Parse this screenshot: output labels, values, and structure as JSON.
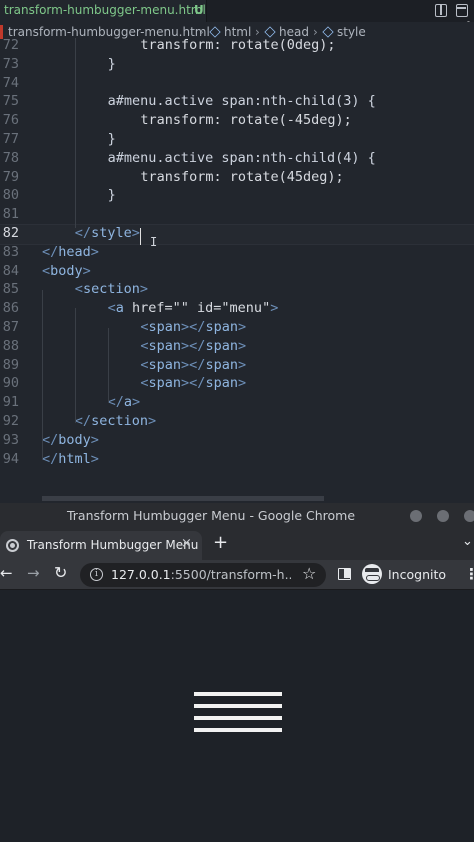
{
  "editor": {
    "tab": {
      "filename": "transform-humbugger-menu.html",
      "status": "U"
    },
    "breadcrumb": [
      {
        "label": "transform-humbugger-menu.html"
      },
      {
        "label": "html",
        "icon": "cube-icon"
      },
      {
        "label": "head",
        "icon": "cube-icon"
      },
      {
        "label": "style",
        "icon": "cube-icon"
      }
    ],
    "current_line": "82",
    "lines": [
      {
        "n": "72",
        "indent": 12,
        "parts": [
          [
            "prop",
            "transform"
          ],
          [
            "val",
            ": rotate(0deg);"
          ]
        ]
      },
      {
        "n": "73",
        "indent": 8,
        "parts": [
          [
            "sel",
            "}"
          ]
        ]
      },
      {
        "n": "74",
        "indent": 0,
        "parts": []
      },
      {
        "n": "75",
        "indent": 8,
        "parts": [
          [
            "sel",
            "a#menu.active span:nth-child(3) {"
          ]
        ]
      },
      {
        "n": "76",
        "indent": 12,
        "parts": [
          [
            "prop",
            "transform"
          ],
          [
            "val",
            ": rotate(-45deg);"
          ]
        ]
      },
      {
        "n": "77",
        "indent": 8,
        "parts": [
          [
            "sel",
            "}"
          ]
        ]
      },
      {
        "n": "78",
        "indent": 8,
        "parts": [
          [
            "sel",
            "a#menu.active span:nth-child(4) {"
          ]
        ]
      },
      {
        "n": "79",
        "indent": 12,
        "parts": [
          [
            "prop",
            "transform"
          ],
          [
            "val",
            ": rotate(45deg);"
          ]
        ]
      },
      {
        "n": "80",
        "indent": 8,
        "parts": [
          [
            "sel",
            "}"
          ]
        ]
      },
      {
        "n": "81",
        "indent": 0,
        "parts": []
      },
      {
        "n": "82",
        "indent": 4,
        "parts": [
          [
            "tag",
            "</"
          ],
          [
            "tn",
            "style"
          ],
          [
            "tag",
            ">"
          ]
        ]
      },
      {
        "n": "83",
        "indent": 0,
        "parts": [
          [
            "tag",
            "</"
          ],
          [
            "tn",
            "head"
          ],
          [
            "tag",
            ">"
          ]
        ]
      },
      {
        "n": "84",
        "indent": 0,
        "parts": [
          [
            "tag",
            "<"
          ],
          [
            "tn",
            "body"
          ],
          [
            "tag",
            ">"
          ]
        ]
      },
      {
        "n": "85",
        "indent": 4,
        "parts": [
          [
            "tag",
            "<"
          ],
          [
            "tn",
            "section"
          ],
          [
            "tag",
            ">"
          ]
        ]
      },
      {
        "n": "86",
        "indent": 8,
        "parts": [
          [
            "tag",
            "<"
          ],
          [
            "tn",
            "a"
          ],
          [
            "attr",
            " href"
          ],
          [
            "str",
            "=\"\" "
          ],
          [
            "attr",
            "id"
          ],
          [
            "str",
            "=\"menu\""
          ],
          [
            "tag",
            ">"
          ]
        ]
      },
      {
        "n": "87",
        "indent": 12,
        "parts": [
          [
            "tag",
            "<"
          ],
          [
            "tn",
            "span"
          ],
          [
            "tag",
            "></"
          ],
          [
            "tn",
            "span"
          ],
          [
            "tag",
            ">"
          ]
        ]
      },
      {
        "n": "88",
        "indent": 12,
        "parts": [
          [
            "tag",
            "<"
          ],
          [
            "tn",
            "span"
          ],
          [
            "tag",
            "></"
          ],
          [
            "tn",
            "span"
          ],
          [
            "tag",
            ">"
          ]
        ]
      },
      {
        "n": "89",
        "indent": 12,
        "parts": [
          [
            "tag",
            "<"
          ],
          [
            "tn",
            "span"
          ],
          [
            "tag",
            "></"
          ],
          [
            "tn",
            "span"
          ],
          [
            "tag",
            ">"
          ]
        ]
      },
      {
        "n": "90",
        "indent": 12,
        "parts": [
          [
            "tag",
            "<"
          ],
          [
            "tn",
            "span"
          ],
          [
            "tag",
            "></"
          ],
          [
            "tn",
            "span"
          ],
          [
            "tag",
            ">"
          ]
        ]
      },
      {
        "n": "91",
        "indent": 8,
        "parts": [
          [
            "tag",
            "</"
          ],
          [
            "tn",
            "a"
          ],
          [
            "tag",
            ">"
          ]
        ]
      },
      {
        "n": "92",
        "indent": 4,
        "parts": [
          [
            "tag",
            "</"
          ],
          [
            "tn",
            "section"
          ],
          [
            "tag",
            ">"
          ]
        ]
      },
      {
        "n": "93",
        "indent": 0,
        "parts": [
          [
            "tag",
            "</"
          ],
          [
            "tn",
            "body"
          ],
          [
            "tag",
            ">"
          ]
        ]
      },
      {
        "n": "94",
        "indent": 0,
        "parts": [
          [
            "tag",
            "</"
          ],
          [
            "tn",
            "html"
          ],
          [
            "tag",
            ">"
          ]
        ]
      }
    ]
  },
  "browser": {
    "window_title": "Transform Humbugger Menu - Google Chrome",
    "tab_title": "Transform Humbugger Menu",
    "tab_close": "×",
    "new_tab": "+",
    "tab_menu": "⌄",
    "url_host": "127.0.0.1",
    "url_rest": ":5500/transform-h...",
    "incognito_label": "Incognito",
    "icons": {
      "back": "←",
      "forward": "→",
      "reload": "↻",
      "star": "☆",
      "menu": "⋮",
      "info": "i"
    },
    "page": {
      "hamburger_bars": 4
    }
  },
  "colors": {
    "editor_bg": "#22262d",
    "tab_text": "#7fc88a",
    "tag": "#8fb5e0",
    "page_bg": "#1e2228"
  }
}
